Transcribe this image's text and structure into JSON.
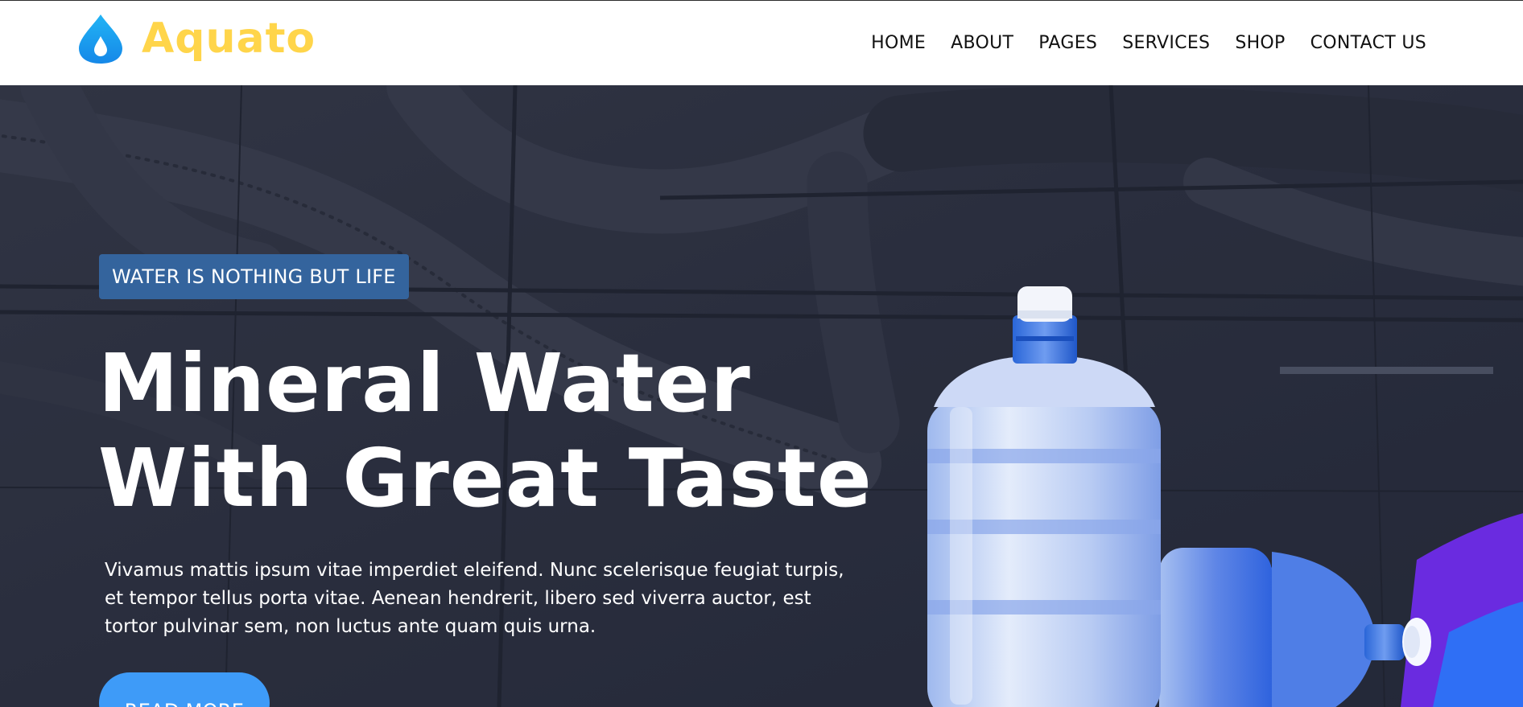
{
  "brand": {
    "name": "Aquato",
    "logo_icon": "water-drop-icon",
    "logo_color": "#ffd54a",
    "icon_color": "#1aa0f0"
  },
  "nav": {
    "items": [
      {
        "label": "HOME"
      },
      {
        "label": "ABOUT"
      },
      {
        "label": "PAGES"
      },
      {
        "label": "SERVICES"
      },
      {
        "label": "SHOP"
      },
      {
        "label": "CONTACT US"
      }
    ]
  },
  "hero": {
    "tagline": "WATER IS NOTHING BUT LIFE",
    "headline_line1": "Mineral Water",
    "headline_line2": "With Great Taste",
    "description_line1": "Vivamus mattis ipsum vitae imperdiet eleifend. Nunc scelerisque feugiat turpis,",
    "description_line2": "et tempor tellus porta vitae. Aenean hendrerit, libero sed viverra auctor, est",
    "description_line3": "tortor pulvinar sem, non luctus ante quam quis urna.",
    "cta_label": "READ MORE",
    "colors": {
      "overlay": "#2c2f3f",
      "tagline_bg": "#34649d",
      "cta_bg": "#3e9bf8",
      "accent_purple": "#6a2be0",
      "accent_blue": "#2f6ff5"
    }
  }
}
